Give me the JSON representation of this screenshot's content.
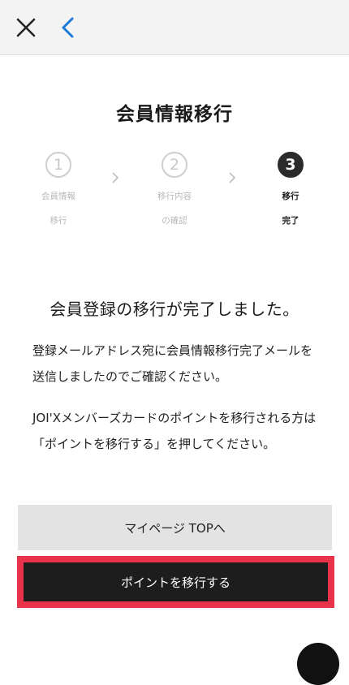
{
  "header": {
    "close_icon": "close-icon",
    "back_icon": "chevron-left-icon",
    "accent": "#1a7ad8"
  },
  "page": {
    "title": "会員情報移行"
  },
  "steps": [
    {
      "number": "1",
      "label": "会員情報\n移行",
      "state": "done"
    },
    {
      "number": "2",
      "label": "移行内容\nの確認",
      "state": "done"
    },
    {
      "number": "3",
      "label": "移行\n完了",
      "state": "active"
    }
  ],
  "main": {
    "complete_message": "会員登録の移行が完了しました。",
    "paragraph1": "登録メールアドレス宛に会員情報移行完了メールを送信しましたのでご確認ください。",
    "paragraph2": "JOI'Xメンバーズカードのポイントを移行される方は「ポイントを移行する」を押してください。"
  },
  "buttons": {
    "mypage_label": "マイページ TOPへ",
    "transfer_points_label": "ポイントを移行する",
    "highlight_color": "#e8334a"
  }
}
